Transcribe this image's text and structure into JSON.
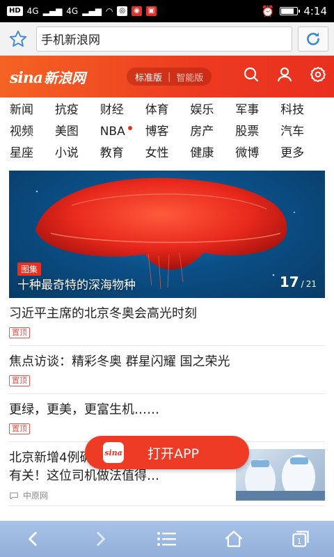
{
  "status_bar": {
    "network_left": "HD",
    "signal1": "4G",
    "signal2": "4G",
    "time": "4:14",
    "battery_level": 0.85
  },
  "address_bar": {
    "url": "手机新浪网"
  },
  "header": {
    "logo_en": "sina",
    "logo_cn": "新浪网",
    "version_standard": "标准版",
    "version_smart": "智能版"
  },
  "channels": [
    "新闻",
    "抗疫",
    "财经",
    "体育",
    "娱乐",
    "军事",
    "科技",
    "视频",
    "美图",
    "NBA",
    "博客",
    "房产",
    "股票",
    "汽车",
    "星座",
    "小说",
    "教育",
    "女性",
    "健康",
    "微博",
    "更多"
  ],
  "hero": {
    "tag": "图集",
    "title": "十种最奇特的深海物种",
    "current": "17",
    "separator": "/",
    "total": "21"
  },
  "news": [
    {
      "title": "习近平主席的北京冬奥会高光时刻",
      "badge": "置顶"
    },
    {
      "title": "焦点访谈：精彩冬奥 群星闪耀 国之荣光",
      "badge": "置顶"
    },
    {
      "title": "更绿，更美，更富生机……",
      "badge": "置顶"
    }
  ],
  "news_img": {
    "title": "北京新增4例确诊病例均与首都某培训班有关！这位司机做法值得…",
    "source": "中原网"
  },
  "open_app": {
    "icon_label": "sina",
    "label": "打开APP"
  },
  "colors": {
    "brand_red": "#e8301f",
    "brand_orange": "#f46323",
    "bottom_bar": "#a9c3e8"
  }
}
